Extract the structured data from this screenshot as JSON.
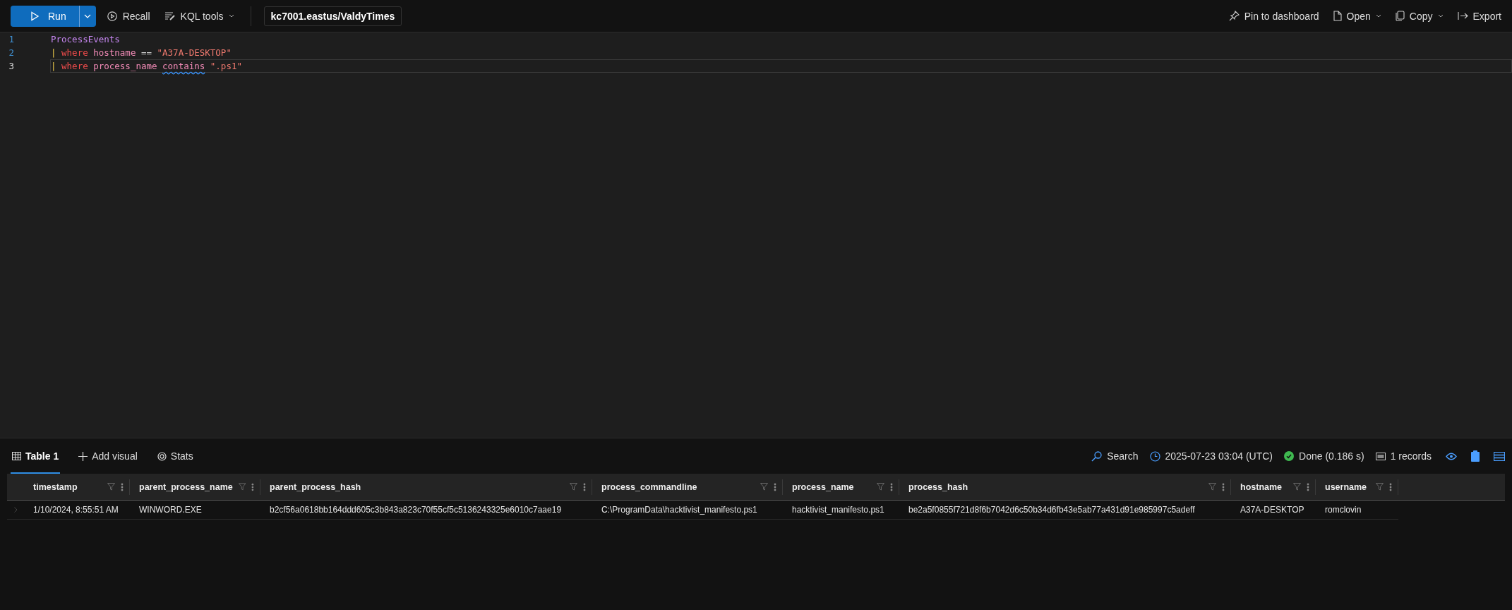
{
  "toolbar": {
    "run_label": "Run",
    "recall_label": "Recall",
    "kql_tools_label": "KQL tools",
    "database": "kc7001.eastus/ValdyTimes",
    "right_actions": [
      {
        "kind": "pin",
        "label": "Pin to dashboard",
        "dropdown": false
      },
      {
        "kind": "open",
        "label": "Open",
        "dropdown": true
      },
      {
        "kind": "copy",
        "label": "Copy",
        "dropdown": true
      },
      {
        "kind": "export",
        "label": "Export",
        "dropdown": false
      }
    ]
  },
  "editor": {
    "lines": [
      {
        "number": "1",
        "current": false,
        "tokens": [
          {
            "text": "ProcessEvents",
            "kind": "table"
          }
        ]
      },
      {
        "number": "2",
        "current": false,
        "tokens": [
          {
            "text": "| ",
            "kind": "pipe"
          },
          {
            "text": "where ",
            "kind": "keyword"
          },
          {
            "text": "hostname",
            "kind": "field"
          },
          {
            "text": " == ",
            "kind": "plain"
          },
          {
            "text": "\"A37A-DESKTOP\"",
            "kind": "string"
          }
        ]
      },
      {
        "number": "3",
        "current": true,
        "tokens": [
          {
            "text": "| ",
            "kind": "pipe"
          },
          {
            "text": "where ",
            "kind": "keyword"
          },
          {
            "text": "process_name ",
            "kind": "field"
          },
          {
            "text": "contains",
            "kind": "field",
            "warning": true
          },
          {
            "text": " \".ps1\"",
            "kind": "string"
          }
        ]
      }
    ]
  },
  "results": {
    "tabs": [
      {
        "kind": "table",
        "label": "Table 1",
        "selected": true
      },
      {
        "kind": "add",
        "label": "Add visual",
        "selected": false
      },
      {
        "kind": "stats",
        "label": "Stats",
        "selected": false
      }
    ],
    "search_label": "Search",
    "time": "2025-07-23 03:04 (UTC)",
    "status": "Done (0.186 s)",
    "records": "1 records"
  },
  "table": {
    "columns": [
      {
        "name": "timestamp"
      },
      {
        "name": "parent_process_name"
      },
      {
        "name": "parent_process_hash"
      },
      {
        "name": "process_commandline"
      },
      {
        "name": "process_name"
      },
      {
        "name": "process_hash"
      },
      {
        "name": "hostname"
      },
      {
        "name": "username"
      }
    ],
    "rows": [
      [
        "1/10/2024, 8:55:51 AM",
        "WINWORD.EXE",
        "b2cf56a0618bb164ddd605c3b843a823c70f55cf5c5136243325e6010c7aae19",
        "C:\\ProgramData\\hacktivist_manifesto.ps1",
        "hacktivist_manifesto.ps1",
        "be2a5f0855f721d8f6b7042d6c50b34d6fb43e5ab77a431d91e985997c5adeff",
        "A37A-DESKTOP",
        "romclovin"
      ]
    ]
  }
}
